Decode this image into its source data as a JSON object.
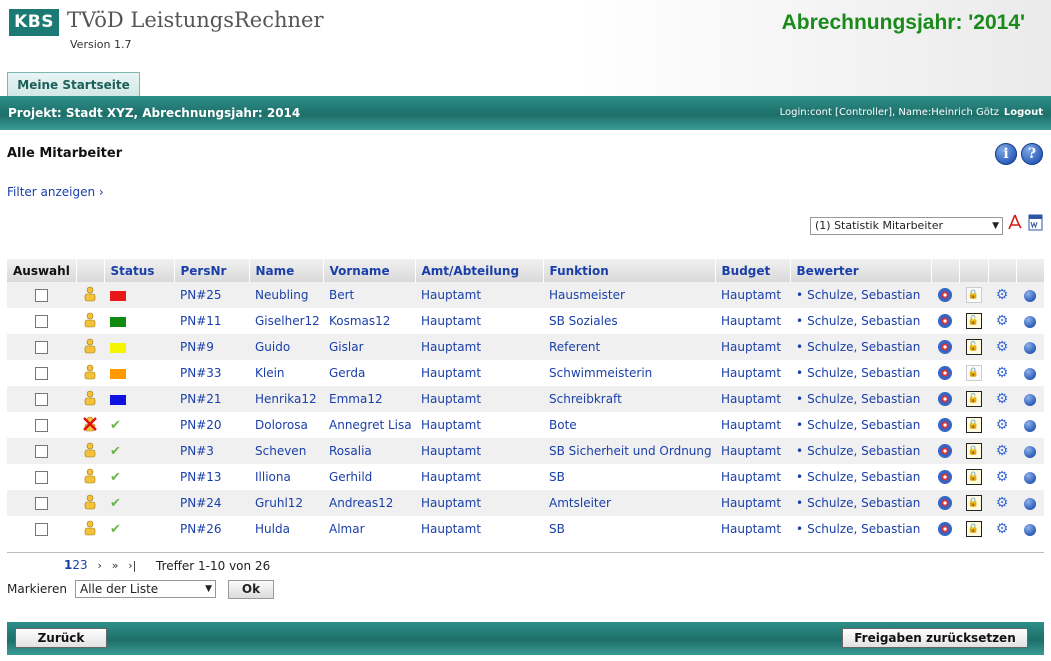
{
  "header": {
    "logo": "KBS",
    "title": "TVöD LeistungsRechner",
    "version": "Version 1.7",
    "year_title": "Abrechnungsjahr: '2014'"
  },
  "tabs": [
    {
      "label": "Meine Startseite"
    }
  ],
  "project_bar": {
    "project": "Projekt: Stadt XYZ, Abrechnungsjahr: 2014",
    "login": "Login:cont [Controller], Name:Heinrich Götz",
    "logout": "Logout"
  },
  "page": {
    "title": "Alle Mitarbeiter",
    "filter_link": "Filter anzeigen ›",
    "statistik_select": "(1) Statistik Mitarbeiter"
  },
  "table": {
    "headers": {
      "auswahl": "Auswahl",
      "status": "Status",
      "persnr": "PersNr",
      "name": "Name",
      "vorname": "Vorname",
      "amt": "Amt/Abteilung",
      "funktion": "Funktion",
      "budget": "Budget",
      "bewerter": "Bewerter"
    },
    "rows": [
      {
        "status_color": "#e81818",
        "persnr": "PN#25",
        "name": "Neubling",
        "vorname": "Bert",
        "amt": "Hauptamt",
        "funktion": "Hausmeister",
        "budget": "Hauptamt",
        "bewerter": "Schulze, Sebastian",
        "lock": "disabled"
      },
      {
        "status_color": "#118a11",
        "persnr": "PN#11",
        "name": "Giselher12",
        "vorname": "Kosmas12",
        "amt": "Hauptamt",
        "funktion": "SB Soziales",
        "budget": "Hauptamt",
        "bewerter": "Schulze, Sebastian",
        "lock": "open"
      },
      {
        "status_color": "#f5f500",
        "persnr": "PN#9",
        "name": "Guido",
        "vorname": "Gislar",
        "amt": "Hauptamt",
        "funktion": "Referent",
        "budget": "Hauptamt",
        "bewerter": "Schulze, Sebastian",
        "lock": "open"
      },
      {
        "status_color": "#ff9a00",
        "persnr": "PN#33",
        "name": "Klein",
        "vorname": "Gerda",
        "amt": "Hauptamt",
        "funktion": "Schwimmeisterin",
        "budget": "Hauptamt",
        "bewerter": "Schulze, Sebastian",
        "lock": "disabled"
      },
      {
        "status_color": "#1010e0",
        "persnr": "PN#21",
        "name": "Henrika12",
        "vorname": "Emma12",
        "amt": "Hauptamt",
        "funktion": "Schreibkraft",
        "budget": "Hauptamt",
        "bewerter": "Schulze, Sebastian",
        "lock": "open"
      },
      {
        "status_color": "check",
        "persnr": "PN#20",
        "name": "Dolorosa",
        "vorname": "Annegret Lisa",
        "amt": "Hauptamt",
        "funktion": "Bote",
        "budget": "Hauptamt",
        "bewerter": "Schulze, Sebastian",
        "lock": "closed",
        "warn": true
      },
      {
        "status_color": "check",
        "persnr": "PN#3",
        "name": "Scheven",
        "vorname": "Rosalia",
        "amt": "Hauptamt",
        "funktion": "SB Sicherheit und Ordnung",
        "budget": "Hauptamt",
        "bewerter": "Schulze, Sebastian",
        "lock": "closed"
      },
      {
        "status_color": "check",
        "persnr": "PN#13",
        "name": "Illiona",
        "vorname": "Gerhild",
        "amt": "Hauptamt",
        "funktion": "SB",
        "budget": "Hauptamt",
        "bewerter": "Schulze, Sebastian",
        "lock": "closed"
      },
      {
        "status_color": "check",
        "persnr": "PN#24",
        "name": "Gruhl12",
        "vorname": "Andreas12",
        "amt": "Hauptamt",
        "funktion": "Amtsleiter",
        "budget": "Hauptamt",
        "bewerter": "Schulze, Sebastian",
        "lock": "closed"
      },
      {
        "status_color": "check",
        "persnr": "PN#26",
        "name": "Hulda",
        "vorname": "Almar",
        "amt": "Hauptamt",
        "funktion": "SB",
        "budget": "Hauptamt",
        "bewerter": "Schulze, Sebastian",
        "lock": "closed"
      }
    ]
  },
  "pager": {
    "pages": [
      "1",
      "2",
      "3"
    ],
    "next": "›",
    "fast_next": "»",
    "last": "›|",
    "hits": "Treffer 1-10 von 26"
  },
  "marking": {
    "label": "Markieren",
    "select_value": "Alle der Liste",
    "ok": "Ok"
  },
  "footer": {
    "back": "Zurück",
    "reset": "Freigaben zurücksetzen"
  }
}
